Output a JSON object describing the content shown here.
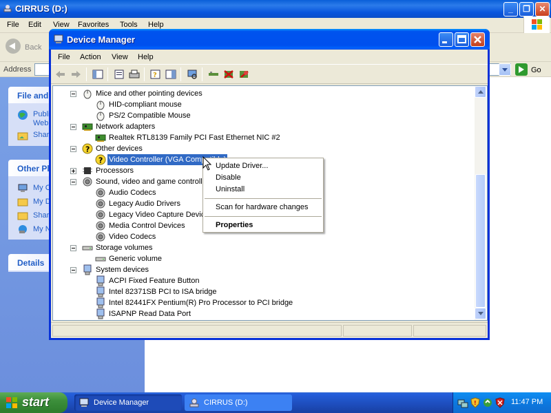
{
  "background_window": {
    "title": "CIRRUS (D:)",
    "menu": [
      "File",
      "Edit",
      "View",
      "Favorites",
      "Tools",
      "Help"
    ],
    "back_label": "Back",
    "address_label": "Address",
    "go_label": "Go",
    "panels": [
      {
        "heading": "File and",
        "items": [
          "Publi",
          "Web",
          "Shar"
        ]
      },
      {
        "heading": "Other Pl",
        "items": [
          "My C",
          "My D",
          "Shar",
          "My N"
        ]
      },
      {
        "heading": "Details",
        "items": []
      }
    ]
  },
  "device_manager": {
    "title": "Device Manager",
    "menu": [
      "File",
      "Action",
      "View",
      "Help"
    ],
    "tree": [
      {
        "label": "Mice and other pointing devices",
        "level": 0,
        "expander": "minus",
        "icon": "mouse-icon"
      },
      {
        "label": "HID-compliant mouse",
        "level": 1,
        "icon": "mouse-icon"
      },
      {
        "label": "PS/2 Compatible Mouse",
        "level": 1,
        "icon": "mouse-icon"
      },
      {
        "label": "Network adapters",
        "level": 0,
        "expander": "minus",
        "icon": "network-card-icon"
      },
      {
        "label": "Realtek RTL8139 Family PCI Fast Ethernet NIC #2",
        "level": 1,
        "icon": "network-card-icon"
      },
      {
        "label": "Other devices",
        "level": 0,
        "expander": "minus",
        "icon": "unknown-device-icon"
      },
      {
        "label": "Video Controller (VGA Compatible)",
        "level": 1,
        "icon": "unknown-device-icon",
        "selected": true
      },
      {
        "label": "Processors",
        "level": 0,
        "expander": "plus",
        "icon": "processor-icon"
      },
      {
        "label": "Sound, video and game controllers",
        "level": 0,
        "expander": "minus",
        "icon": "speaker-icon"
      },
      {
        "label": "Audio Codecs",
        "level": 1,
        "icon": "speaker-icon"
      },
      {
        "label": "Legacy Audio Drivers",
        "level": 1,
        "icon": "speaker-icon"
      },
      {
        "label": "Legacy Video Capture Devices",
        "level": 1,
        "icon": "speaker-icon"
      },
      {
        "label": "Media Control Devices",
        "level": 1,
        "icon": "speaker-icon"
      },
      {
        "label": "Video Codecs",
        "level": 1,
        "icon": "speaker-icon"
      },
      {
        "label": "Storage volumes",
        "level": 0,
        "expander": "minus",
        "icon": "drive-icon"
      },
      {
        "label": "Generic volume",
        "level": 1,
        "icon": "drive-icon"
      },
      {
        "label": "System devices",
        "level": 0,
        "expander": "minus",
        "icon": "computer-icon"
      },
      {
        "label": "ACPI Fixed Feature Button",
        "level": 1,
        "icon": "computer-icon"
      },
      {
        "label": "Intel 82371SB PCI to ISA bridge",
        "level": 1,
        "icon": "computer-icon"
      },
      {
        "label": "Intel 82441FX Pentium(R) Pro Processor to PCI bridge",
        "level": 1,
        "icon": "computer-icon"
      },
      {
        "label": "ISAPNP Read Data Port",
        "level": 1,
        "icon": "computer-icon"
      }
    ]
  },
  "context_menu": {
    "items": [
      {
        "label": "Update Driver...",
        "bold": false
      },
      {
        "label": "Disable",
        "bold": false
      },
      {
        "label": "Uninstall",
        "bold": false
      },
      {
        "separator": true
      },
      {
        "label": "Scan for hardware changes",
        "bold": false
      },
      {
        "separator": true
      },
      {
        "label": "Properties",
        "bold": true
      }
    ]
  },
  "taskbar": {
    "start_label": "start",
    "tasks": [
      {
        "label": "Device Manager",
        "active": true
      },
      {
        "label": "CIRRUS (D:)",
        "active": false
      }
    ],
    "clock": "11:47 PM"
  }
}
